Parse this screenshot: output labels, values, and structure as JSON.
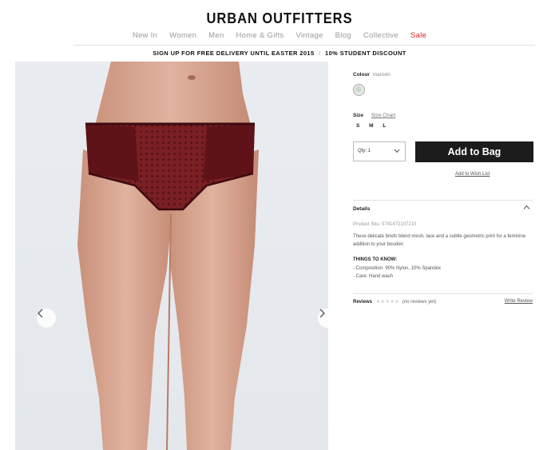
{
  "brand": {
    "logo": "URBAN OUTFITTERS"
  },
  "nav": {
    "items": [
      "New In",
      "Women",
      "Men",
      "Home & Gifts",
      "Vintage",
      "Blog",
      "Collective",
      "Sale"
    ],
    "sale_color": "#e02020"
  },
  "promo": {
    "part1": "SIGN UP FOR FREE DELIVERY UNTIL EASTER 2015",
    "separator": "/",
    "part2": "10% STUDENT DISCOUNT"
  },
  "gallery": {
    "prev_icon": "chevron-left-icon",
    "next_icon": "chevron-right-icon"
  },
  "product": {
    "colour_label": "Colour",
    "colour_value": "maroon",
    "size_label": "Size",
    "size_chart_label": "Size Chart",
    "sizes": [
      "S",
      "M",
      "L"
    ],
    "qty_label": "Qty: 1",
    "add_to_bag": "Add to Bag",
    "add_to_wishlist": "Add to Wish List",
    "details_label": "Details",
    "sku": "Product Sku: 5741472107210",
    "description": "These delicate briefs blend mesh, lace and a subtle geometric print for a feminine addition to your boudoir.",
    "things_to_know": "THINGS TO KNOW:",
    "specs": [
      "- Composition: 90% Nylon, 10% Spandex",
      "- Care: Hand wash"
    ],
    "reviews_label": "Reviews",
    "reviews_stars": "★★★★★",
    "reviews_count": "(no reviews yet)",
    "write_review": "Write Review",
    "accent_color": "#1c1c1c"
  }
}
